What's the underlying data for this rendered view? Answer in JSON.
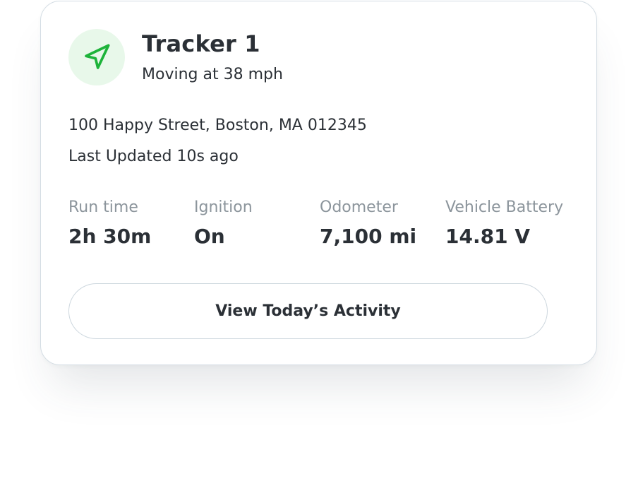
{
  "tracker": {
    "name": "Tracker 1",
    "status": "Moving at 38 mph",
    "icon": "navigation-arrow-icon",
    "accent_color": "#1db33a",
    "icon_bg_color": "#e8f8ea"
  },
  "location": {
    "address": "100 Happy Street, Boston, MA 012345",
    "last_updated": "Last Updated 10s ago"
  },
  "stats": [
    {
      "label": "Run time",
      "value": "2h 30m"
    },
    {
      "label": "Ignition",
      "value": "On"
    },
    {
      "label": "Odometer",
      "value": "7,100 mi"
    },
    {
      "label": "Vehicle Battery",
      "value": "14.81 V"
    }
  ],
  "actions": {
    "view_activity_label": "View Today’s Activity"
  }
}
